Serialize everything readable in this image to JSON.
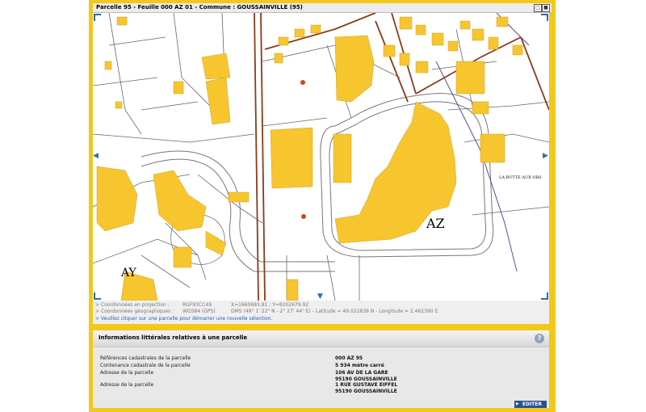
{
  "window": {
    "title": "Parcelle 95 - Feuille 000 AZ 01 - Commune : GOUSSAINVILLE (95)",
    "restore_icon": "restore-icon",
    "maximize_icon": "maximize-icon"
  },
  "map": {
    "labels": {
      "az": "AZ",
      "ay": "AY",
      "place": "LA BUTTE AUX ORS"
    },
    "colors": {
      "building": "#f7c62f",
      "road_primary": "#8b3a1a",
      "road_secondary": "#666666",
      "boundary": "#5b4aa0",
      "parcel_dot": "#c84a1a"
    },
    "nav_arrows": [
      "arrow-left-icon",
      "arrow-right-icon",
      "arrow-down-icon"
    ]
  },
  "coords": {
    "proj_label": "> Coordonnées en projection :",
    "proj_system": "RGF93CC49",
    "proj_value": "X=1660683.81 ; Y=8202679.92",
    "geo_label": "> Coordonnées géographiques :",
    "geo_system": "WGS84 (GPS)",
    "geo_value": "DMS (49° 1' 22\" N - 2° 27' 44\" E) - Latitude = 49.022839 N - Longitude = 2.462390 E",
    "message": "> Veuillez cliquer sur une parcelle pour démarrer une nouvelle sélection."
  },
  "panel": {
    "title": "Informations littérales relatives à une parcelle",
    "help": "?",
    "rows": [
      {
        "label": "Références cadastrales de la parcelle",
        "value": "000 AZ 95"
      },
      {
        "label": "Contenance cadastrale de la parcelle",
        "value": "5 934 mètre carré"
      },
      {
        "label": "Adresse de la parcelle",
        "value": "106 AV DE LA GARE"
      },
      {
        "label": "",
        "value": "95190 GOUSSAINVILLE"
      },
      {
        "label": "Adresse de la parcelle",
        "value": "1 RUE GUSTAVE EIFFEL"
      },
      {
        "label": "",
        "value": "95190 GOUSSAINVILLE"
      }
    ],
    "edit_button": "EDITER"
  }
}
